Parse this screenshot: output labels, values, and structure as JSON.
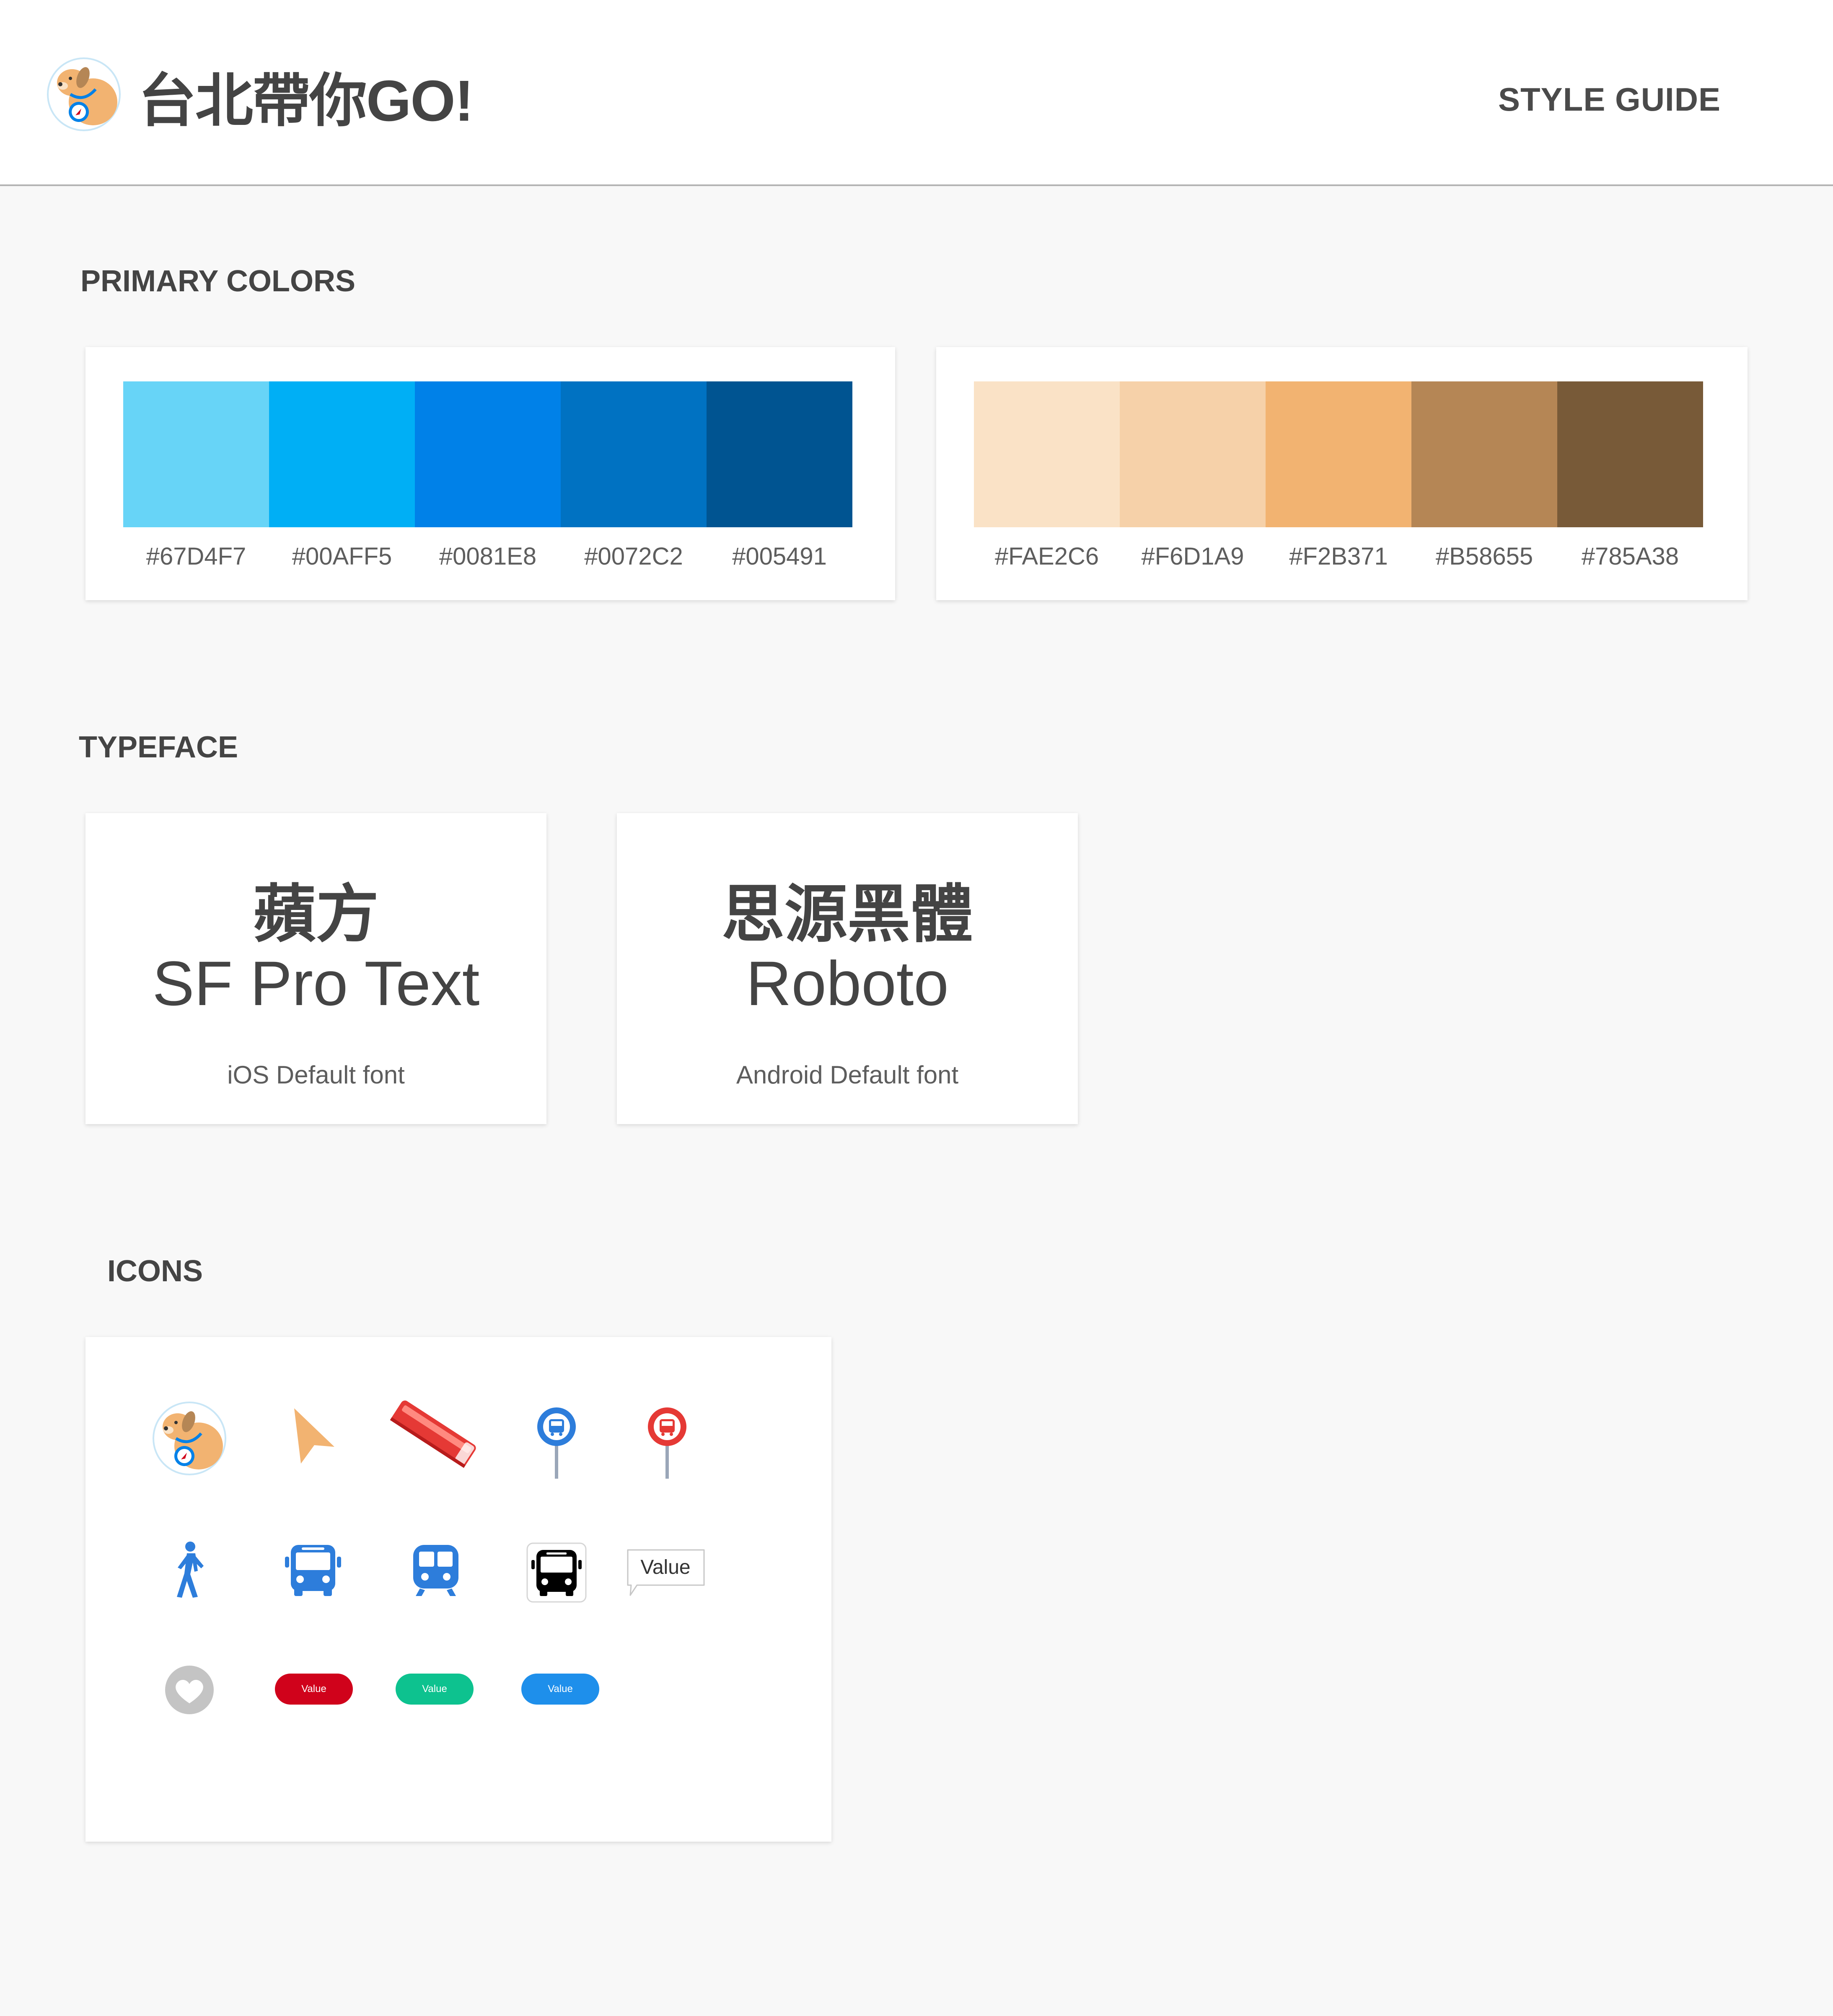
{
  "header": {
    "app_title": "台北帶你GO!",
    "logo_icon": "dog-mascot-icon",
    "style_guide_link": "STYLE GUIDE"
  },
  "primary_colors": {
    "title": "PRIMARY COLORS",
    "blue_palette": [
      {
        "hex": "#67D4F7",
        "label": "#67D4F7"
      },
      {
        "hex": "#00AFF5",
        "label": "#00AFF5"
      },
      {
        "hex": "#0081E8",
        "label": "#0081E8"
      },
      {
        "hex": "#0072C2",
        "label": "#0072C2"
      },
      {
        "hex": "#005491",
        "label": "#005491"
      }
    ],
    "tan_palette": [
      {
        "hex": "#FAE2C6",
        "label": "#FAE2C6"
      },
      {
        "hex": "#F6D1A9",
        "label": "#F6D1A9"
      },
      {
        "hex": "#F2B371",
        "label": "#F2B371"
      },
      {
        "hex": "#B58655",
        "label": "#B58655"
      },
      {
        "hex": "#785A38",
        "label": "#785A38"
      }
    ]
  },
  "typeface": {
    "title": "TYPEFACE",
    "fonts": [
      {
        "cn_name": "蘋方",
        "en_name": "SF Pro Text",
        "note": "iOS Default font"
      },
      {
        "cn_name": "思源黑體",
        "en_name": "Roboto",
        "note": "Android Default font"
      }
    ]
  },
  "icons": {
    "title": "ICONS",
    "row1": [
      "dog-mascot-icon",
      "navigation-arrow-icon",
      "red-bus-icon",
      "blue-bus-stop-pin-icon",
      "red-bus-stop-pin-icon"
    ],
    "row2": [
      "pedestrian-icon",
      "bus-icon",
      "train-icon",
      "black-bus-icon",
      "value-callout"
    ],
    "row3": [
      "heart-icon",
      "red-value-pill",
      "green-value-pill",
      "blue-value-pill"
    ],
    "callout_label": "Value",
    "pills": [
      {
        "label": "Value",
        "color": "#D0021B"
      },
      {
        "label": "Value",
        "color": "#0DC28F"
      },
      {
        "label": "Value",
        "color": "#1E8FEB"
      }
    ]
  }
}
